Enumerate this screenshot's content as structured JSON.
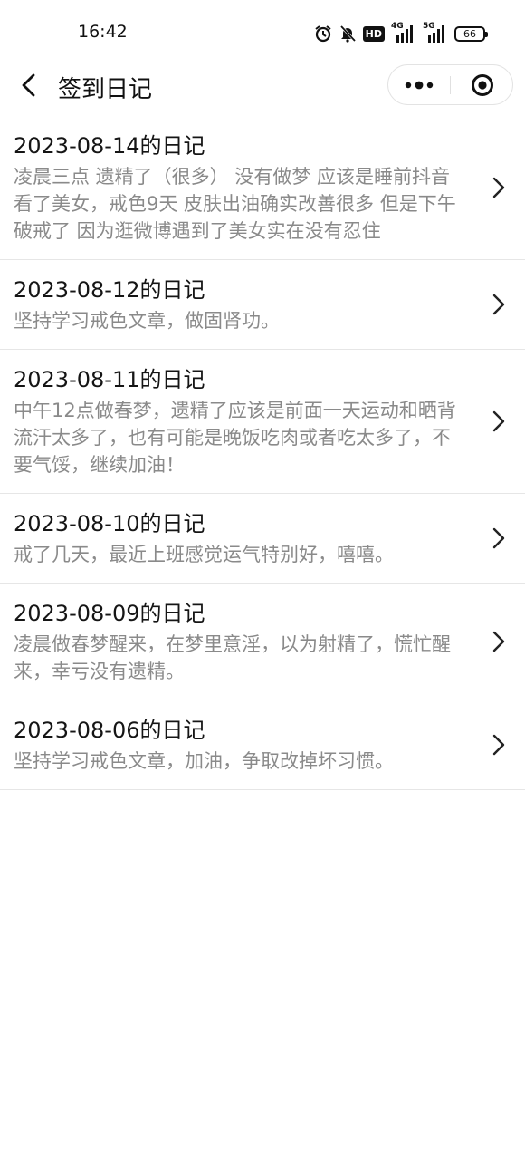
{
  "status_bar": {
    "time": "16:42",
    "icons": [
      "alarm-icon",
      "mute-icon",
      "hd-icon",
      "signal-4g-icon",
      "signal-5g-icon",
      "battery-icon"
    ],
    "hd_label": "HD",
    "net1_label": "4G",
    "net2_label": "5G",
    "battery": "66"
  },
  "nav": {
    "title": "签到日记",
    "back_icon": "chevron-left-icon",
    "more_icon": "more-dots-icon",
    "close_icon": "target-close-icon"
  },
  "diary": [
    {
      "title": "2023-08-14的日记",
      "content": "凌晨三点 遗精了（很多） 没有做梦 应该是睡前抖音看了美女，戒色9天 皮肤出油确实改善很多 但是下午破戒了 因为逛微博遇到了美女实在没有忍住"
    },
    {
      "title": "2023-08-12的日记",
      "content": "坚持学习戒色文章，做固肾功。"
    },
    {
      "title": "2023-08-11的日记",
      "content": "中午12点做春梦，遗精了应该是前面一天运动和晒背流汗太多了，也有可能是晚饭吃肉或者吃太多了，不要气馁，继续加油！"
    },
    {
      "title": "2023-08-10的日记",
      "content": "戒了几天，最近上班感觉运气特别好，嘻嘻。"
    },
    {
      "title": "2023-08-09的日记",
      "content": "凌晨做春梦醒来，在梦里意淫，以为射精了，慌忙醒来，幸亏没有遗精。"
    },
    {
      "title": "2023-08-06的日记",
      "content": "坚持学习戒色文章，加油，争取改掉坏习惯。"
    }
  ],
  "colors": {
    "title_text": "#151515",
    "content_text": "#8a8a8a",
    "divider": "#e6e6e6",
    "background": "#ffffff"
  }
}
